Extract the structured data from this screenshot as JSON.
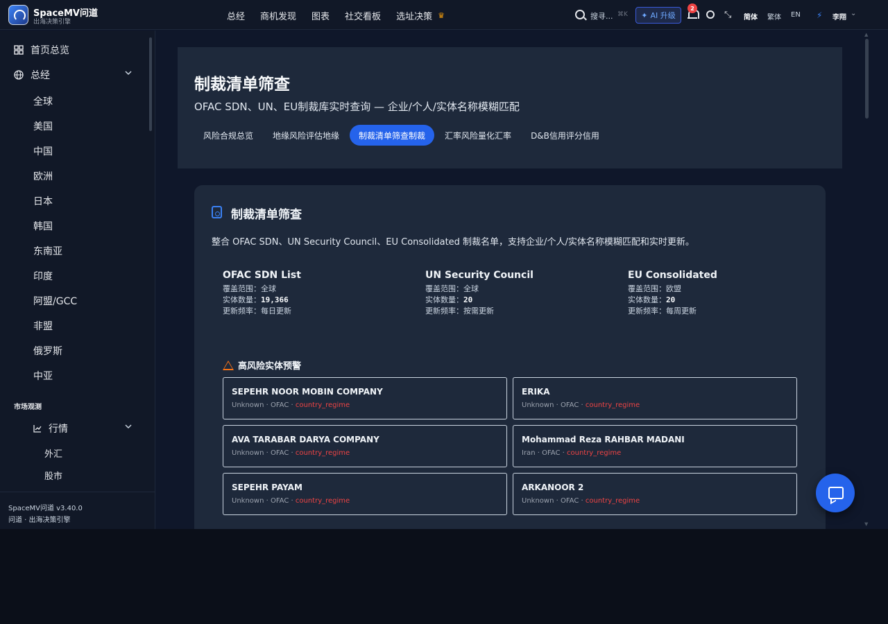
{
  "brand": {
    "title": "SpaceMV问道",
    "subtitle": "出海决策引擎"
  },
  "nav": [
    "总经",
    "商机发现",
    "图表",
    "社交看板",
    "选址决策"
  ],
  "search": {
    "placeholder": "搜寻...",
    "shortcut": "⌘K"
  },
  "ai_button": "AI 升级",
  "notifications": {
    "count": "2"
  },
  "languages": {
    "simplified": "简体",
    "traditional": "繁体",
    "english": "EN"
  },
  "user": {
    "name": "李翔"
  },
  "sidebar": {
    "home": "首页总览",
    "macro": "总经",
    "regions": [
      "全球",
      "美国",
      "中国",
      "欧洲",
      "日本",
      "韩国",
      "东南亚",
      "印度",
      "阿盟/GCC",
      "非盟",
      "俄罗斯",
      "中亚"
    ],
    "section_market": "市场观测",
    "market": "行情",
    "market_items": [
      "外汇",
      "股市"
    ],
    "version": "SpaceMV问道 v3.40.0",
    "footer": "问道 · 出海决策引擎"
  },
  "hero": {
    "title": "制裁清单筛查",
    "subtitle": "OFAC SDN、UN、EU制裁库实时查询 — 企业/个人/实体名称模糊匹配",
    "tabs": [
      "风险合规总览",
      "地缘风险评估地缘",
      "制裁清单筛查制裁",
      "汇率风险量化汇率",
      "D&B信用评分信用"
    ],
    "active_tab": 2
  },
  "card": {
    "title": "制裁清单筛查",
    "description": "整合 OFAC SDN、UN Security Council、EU Consolidated 制裁名单，支持企业/个人/实体名称模糊匹配和实时更新。",
    "sources": [
      {
        "name": "OFAC SDN List",
        "scope_label": "覆盖范围：",
        "scope": "全球",
        "count_label": "实体数量：",
        "count": "19,366",
        "freq_label": "更新频率：",
        "freq": "每日更新"
      },
      {
        "name": "UN Security Council",
        "scope_label": "覆盖范围：",
        "scope": "全球",
        "count_label": "实体数量：",
        "count": "20",
        "freq_label": "更新频率：",
        "freq": "按需更新"
      },
      {
        "name": "EU Consolidated",
        "scope_label": "覆盖范围：",
        "scope": "欧盟",
        "count_label": "实体数量：",
        "count": "20",
        "freq_label": "更新频率：",
        "freq": "每周更新"
      }
    ],
    "alert_title": "高风险实体预警",
    "entities": [
      {
        "name": "SEPEHR NOOR MOBIN COMPANY",
        "country": "Unknown",
        "list": "OFAC",
        "tag": "country_regime"
      },
      {
        "name": "ERIKA",
        "country": "Unknown",
        "list": "OFAC",
        "tag": "country_regime"
      },
      {
        "name": "AVA TARABAR DARYA COMPANY",
        "country": "Unknown",
        "list": "OFAC",
        "tag": "country_regime"
      },
      {
        "name": "Mohammad Reza RAHBAR MADANI",
        "country": "Iran",
        "list": "OFAC",
        "tag": "country_regime"
      },
      {
        "name": "SEPEHR PAYAM",
        "country": "Unknown",
        "list": "OFAC",
        "tag": "country_regime"
      },
      {
        "name": "ARKANOOR 2",
        "country": "Unknown",
        "list": "OFAC",
        "tag": "country_regime"
      }
    ]
  },
  "colors": {
    "accent": "#2563eb",
    "danger": "#ef4444",
    "warning": "#f97316",
    "background": "#0f172a",
    "panel": "#1e293b"
  },
  "icons": [
    "search-icon",
    "sparkle-icon",
    "bell-icon",
    "sun-icon",
    "collapse-icon",
    "user-icon",
    "grid-icon",
    "globe-icon",
    "chart-icon",
    "file-search-icon",
    "warning-icon",
    "chat-icon"
  ]
}
